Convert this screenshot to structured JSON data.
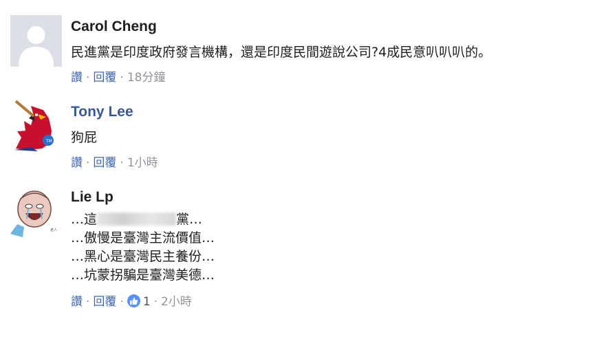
{
  "comments": [
    {
      "name": "Carol Cheng",
      "lines": [
        "民進黨是印度政府發言機構，還是印度民間遊說公司?4成民意叭叭叭的。"
      ],
      "actions": {
        "like": "讚",
        "reply": "回覆",
        "time": "18分鐘"
      }
    },
    {
      "name": "Tony Lee",
      "lines": [
        "狗屁"
      ],
      "actions": {
        "like": "讚",
        "reply": "回覆",
        "time": "1小時"
      }
    },
    {
      "name": "Lie Lp",
      "lines": [
        "…這",
        "黨…",
        "…傲慢是臺灣主流價值…",
        "…黑心是臺灣民主養份…",
        "…坑蒙拐騙是臺灣美德…"
      ],
      "actions": {
        "like": "讚",
        "reply": "回覆",
        "reaction_count": "1",
        "time": "2小時"
      }
    }
  ],
  "colors": {
    "name_link": "#385898",
    "action_link": "#4267b2",
    "meta": "#90949c",
    "text": "#1c1e21",
    "like_badge": "#5890ff"
  }
}
